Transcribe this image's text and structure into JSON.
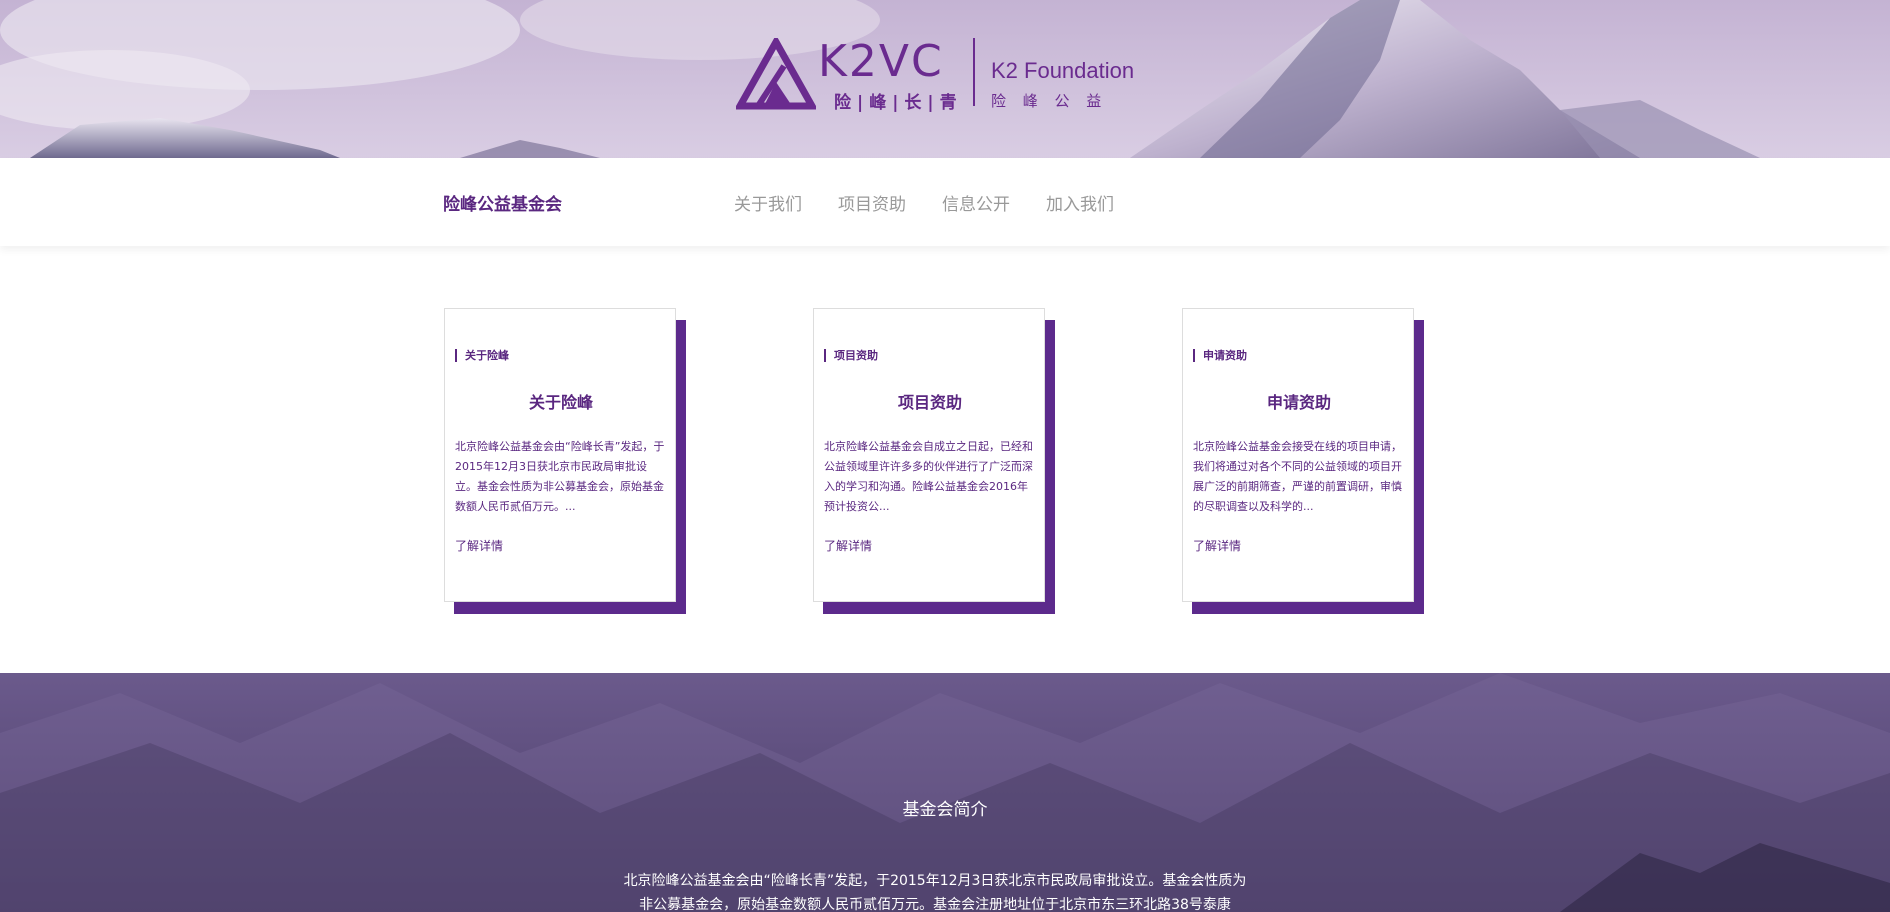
{
  "hero": {
    "logo_mark": "K2VC",
    "logo_cn": "险|峰|长|青",
    "logo_en": "K2 Foundation",
    "logo_en_cn": "险 峰 公 益",
    "icon": "mountain-triangle-logo-icon"
  },
  "navbar": {
    "brand": "险峰公益基金会",
    "items": [
      {
        "label": "关于我们"
      },
      {
        "label": "项目资助"
      },
      {
        "label": "信息公开"
      },
      {
        "label": "加入我们"
      }
    ]
  },
  "cards": [
    {
      "tag": "关于险峰",
      "title": "关于险峰",
      "text": "北京险峰公益基金会由“险峰长青”发起，于2015年12月3日获北京市民政局审批设立。基金会性质为非公募基金会，原始基金数额人民币贰佰万元。...",
      "link": "了解详情"
    },
    {
      "tag": "项目资助",
      "title": "项目资助",
      "text": "北京险峰公益基金会自成立之日起，已经和公益领域里许许多多的伙伴进行了广泛而深入的学习和沟通。险峰公益基金会2016年预计投资公...",
      "link": "了解详情"
    },
    {
      "tag": "申请资助",
      "title": "申请资助",
      "text": "北京险峰公益基金会接受在线的项目申请，我们将通过对各个不同的公益领域的项目开展广泛的前期筛查，严谨的前置调研，审慎的尽职调查以及科学的...",
      "link": "了解详情"
    }
  ],
  "intro": {
    "title": "基金会简介",
    "text": "北京险峰公益基金会由“险峰长青”发起，于2015年12月3日获北京市民政局审批设立。基金会性质为非公募基金会，原始基金数额人民币贰佰万元。基金会注册地址位于北京市东三环北路38号泰康"
  },
  "colors": {
    "brand_purple": "#5a2780",
    "card_shadow": "#5c2a8c",
    "nav_gray": "#999999"
  }
}
